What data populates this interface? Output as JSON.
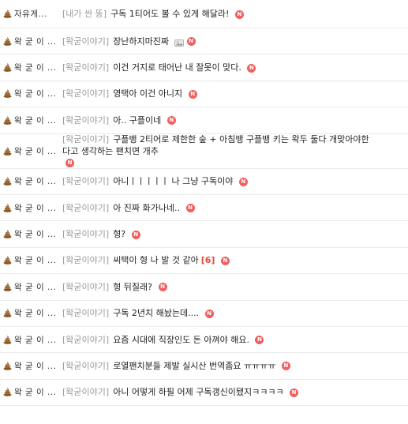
{
  "new_badge": "N",
  "rows": [
    {
      "author": "자유게...",
      "tag": "[내가 싼 똥]",
      "title": "구독 1티어도 볼 수 있게 해달라!",
      "title2": "",
      "comments": "",
      "image": false,
      "new": true,
      "poo": true
    },
    {
      "author": "왁 굳 이 ...",
      "tag": "[왁굳이야기]",
      "title": "장난하지마진짜",
      "title2": "",
      "comments": "",
      "image": true,
      "new": true,
      "poo": true
    },
    {
      "author": "왁 굳 이 ...",
      "tag": "[왁굳이야기]",
      "title": "이건 거지로 태어난 내 잘못이 맞다.",
      "title2": "",
      "comments": "",
      "image": false,
      "new": true,
      "poo": true
    },
    {
      "author": "왁 굳 이 ...",
      "tag": "[왁굳이야기]",
      "title": "영택아 이건 아니지",
      "title2": "",
      "comments": "",
      "image": false,
      "new": true,
      "poo": true
    },
    {
      "author": "왁 굳 이 ...",
      "tag": "[왁굳이야기]",
      "title": "아.. 구플이네",
      "title2": "",
      "comments": "",
      "image": false,
      "new": true,
      "poo": true
    },
    {
      "author": "왁 굳 이 ...",
      "tag": "[왁굳이야기]",
      "title": "구플뱅 2티어로 제한한 숲 + 아침뱅 구플뱅 키는 왁두 둘다 개맞아야한",
      "title2": "다고 생각하는 팬치면 개추",
      "comments": "",
      "image": false,
      "new": true,
      "poo": true
    },
    {
      "author": "왁 굳 이 ...",
      "tag": "[왁굳이야기]",
      "title": "아니ㅣㅣㅣㅣㅣ 나 그냥 구독이야",
      "title2": "",
      "comments": "",
      "image": false,
      "new": true,
      "poo": true
    },
    {
      "author": "왁 굳 이 ...",
      "tag": "[왁굳이야기]",
      "title": "아 진짜 화가나네..",
      "title2": "",
      "comments": "",
      "image": false,
      "new": true,
      "poo": true
    },
    {
      "author": "왁 굳 이 ...",
      "tag": "[왁굳이야기]",
      "title": "형?",
      "title2": "",
      "comments": "",
      "image": false,
      "new": true,
      "poo": true
    },
    {
      "author": "왁 굳 이 ...",
      "tag": "[왁굳이야기]",
      "title": "씨택이 형 나 발 것 같아",
      "title2": "",
      "comments": "[6]",
      "image": false,
      "new": true,
      "poo": true
    },
    {
      "author": "왁 굳 이 ...",
      "tag": "[왁굳이야기]",
      "title": "형 뒤질래?",
      "title2": "",
      "comments": "",
      "image": false,
      "new": true,
      "poo": true
    },
    {
      "author": "왁 굳 이 ...",
      "tag": "[왁굳이야기]",
      "title": "구독 2년치 해놨는데....",
      "title2": "",
      "comments": "",
      "image": false,
      "new": true,
      "poo": true
    },
    {
      "author": "왁 굳 이 ...",
      "tag": "[왁굳이야기]",
      "title": "요즘 시대에 직장인도 돈 아껴야 해요.",
      "title2": "",
      "comments": "",
      "image": false,
      "new": true,
      "poo": true
    },
    {
      "author": "왁 굳 이 ...",
      "tag": "[왁굳이야기]",
      "title": "로열팬치분들 제발 실시산 번역좀요 ㅠㅠㅠㅠ",
      "title2": "",
      "comments": "",
      "image": false,
      "new": true,
      "poo": true
    },
    {
      "author": "왁 굳 이 ...",
      "tag": "[왁굳이야기]",
      "title": "아니 어떻게 하필 어제 구독갱신이됐지ㅋㅋㅋㅋ",
      "title2": "",
      "comments": "",
      "image": false,
      "new": true,
      "poo": true
    }
  ],
  "colors": {
    "tag": "#999999",
    "new_badge": "#f15f5f",
    "comment_count": "#e8473a",
    "divider": "#ebebeb"
  },
  "icons": {
    "author_icon": "poop-icon",
    "image_icon": "image-attachment-icon",
    "new_icon": "new-badge-icon"
  }
}
